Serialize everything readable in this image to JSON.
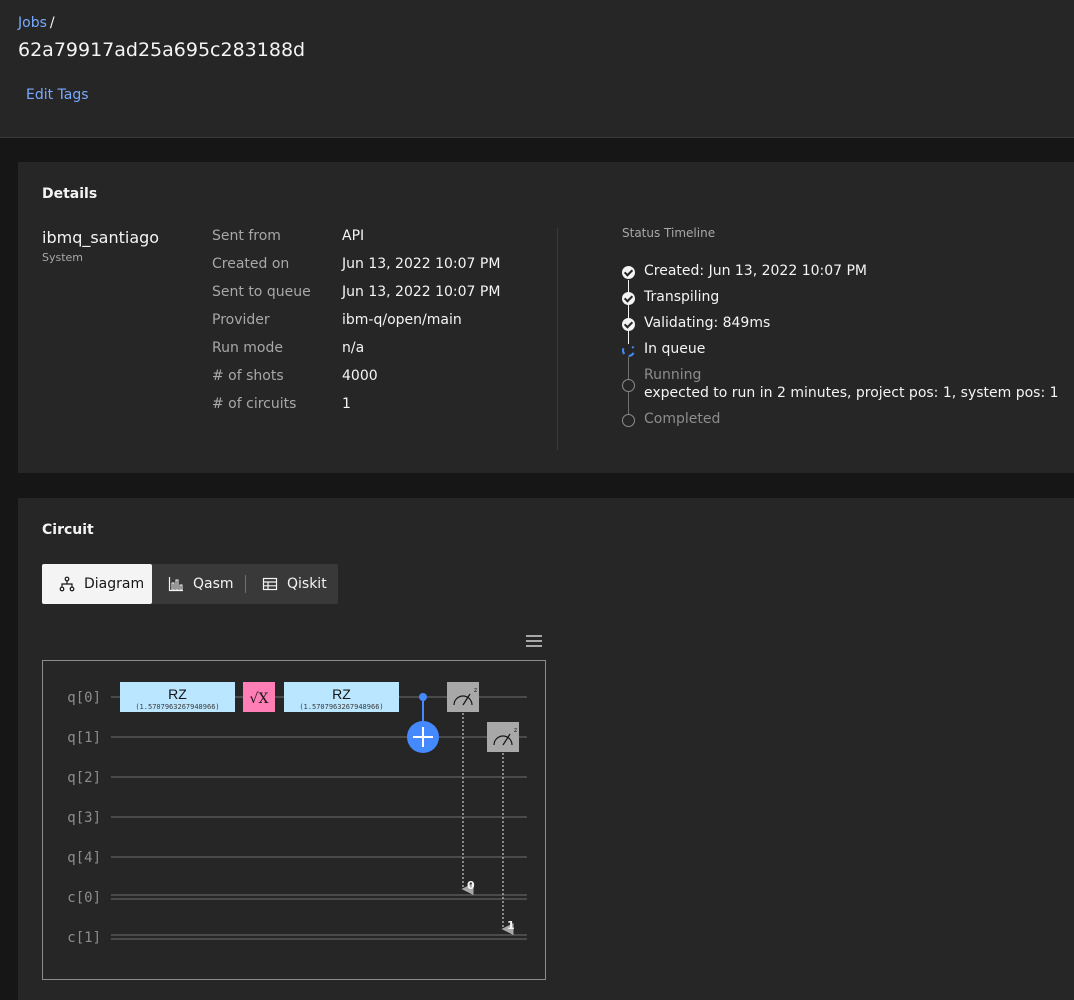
{
  "header": {
    "breadcrumb_link": "Jobs",
    "breadcrumb_sep": "/",
    "job_id": "62a79917ad25a695c283188d",
    "edit_tags": "Edit Tags"
  },
  "details": {
    "title": "Details",
    "system_name": "ibmq_santiago",
    "system_label": "System",
    "fields": [
      {
        "label": "Sent from",
        "value": "API"
      },
      {
        "label": "Created on",
        "value": "Jun 13, 2022 10:07 PM"
      },
      {
        "label": "Sent to queue",
        "value": "Jun 13, 2022 10:07 PM"
      },
      {
        "label": "Provider",
        "value": "ibm-q/open/main"
      },
      {
        "label": "Run mode",
        "value": "n/a"
      },
      {
        "label": "# of shots",
        "value": "4000"
      },
      {
        "label": "# of circuits",
        "value": "1"
      }
    ],
    "timeline": {
      "title": "Status Timeline",
      "steps": [
        {
          "label": "Created: Jun 13, 2022 10:07 PM",
          "state": "done"
        },
        {
          "label": "Transpiling",
          "state": "done"
        },
        {
          "label": "Validating: 849ms",
          "state": "done"
        },
        {
          "label": "In queue",
          "state": "active"
        },
        {
          "label": "Running",
          "sub": "expected to run in 2 minutes, project pos: 1, system pos: 1",
          "state": "pending"
        },
        {
          "label": "Completed",
          "state": "pending"
        }
      ]
    }
  },
  "circuit": {
    "title": "Circuit",
    "tabs": [
      "Diagram",
      "Qasm",
      "Qiskit"
    ],
    "active_tab": "Diagram",
    "qubits": [
      "q[0]",
      "q[1]",
      "q[2]",
      "q[3]",
      "q[4]"
    ],
    "clbits": [
      "c[0]",
      "c[1]"
    ],
    "gates": {
      "rz_label": "RZ",
      "rz_param": "(1.5707963267948966)",
      "sx_label": "√X"
    },
    "measure_targets": [
      "0",
      "1"
    ],
    "colors": {
      "rz": "#bae6ff",
      "sx": "#ff7eb6",
      "cnot": "#4589ff",
      "measure": "#a8a8a8"
    }
  }
}
